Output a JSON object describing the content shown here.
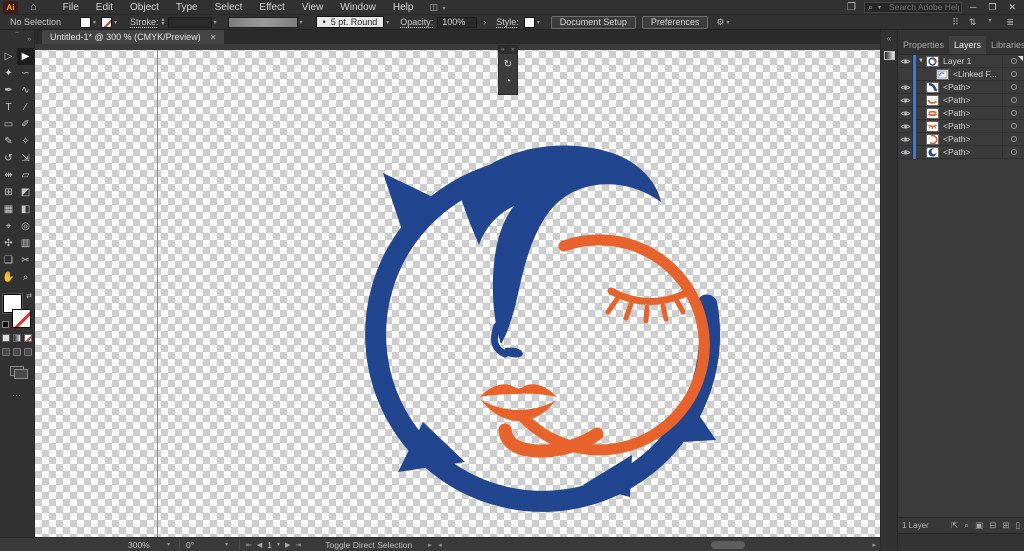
{
  "titlebar": {
    "app_badge": "Ai",
    "menus": [
      "File",
      "Edit",
      "Object",
      "Type",
      "Select",
      "Effect",
      "View",
      "Window",
      "Help"
    ],
    "search_placeholder": "Search Adobe Help",
    "icons": {
      "home": "⌂",
      "workspace": "◫",
      "arrange": "❐",
      "search": "⌕",
      "minimize": "─",
      "restore": "❐",
      "close": "✕",
      "chevron": "▾"
    }
  },
  "control_bar": {
    "selection_status": "No Selection",
    "stroke_label": "Stroke:",
    "brush_bullet": "•",
    "brush_preset": "5 pt. Round",
    "opacity_label": "Opacity:",
    "opacity_value": "100%",
    "opacity_more": "›",
    "style_label": "Style:",
    "document_setup_label": "Document Setup",
    "preferences_label": "Preferences",
    "right_icons": [
      {
        "name": "settings-icon",
        "glyph": "⚙"
      },
      {
        "name": "grid-icon",
        "glyph": "⠿"
      },
      {
        "name": "panel-toggle-icon",
        "glyph": "⇅"
      },
      {
        "name": "list-view-icon",
        "glyph": "≣"
      }
    ]
  },
  "document_tab": {
    "title": "Untitled-1* @ 300 % (CMYK/Preview)",
    "close_glyph": "✕"
  },
  "toolbar": {
    "more_glyph": "»",
    "ellipsis": "…",
    "tools": [
      {
        "name": "direct-selection-tool",
        "glyph": "▷",
        "active": false
      },
      {
        "name": "selection-tool",
        "glyph": "▶",
        "active": true
      },
      {
        "name": "magic-wand-tool",
        "glyph": "✦",
        "active": false
      },
      {
        "name": "lasso-tool",
        "glyph": "∽",
        "active": false
      },
      {
        "name": "pen-tool",
        "glyph": "✒",
        "active": false
      },
      {
        "name": "curvature-tool",
        "glyph": "∿",
        "active": false
      },
      {
        "name": "type-tool",
        "glyph": "T",
        "active": false
      },
      {
        "name": "line-segment-tool",
        "glyph": "∕",
        "active": false
      },
      {
        "name": "rectangle-tool",
        "glyph": "▭",
        "active": false
      },
      {
        "name": "paintbrush-tool",
        "glyph": "✐",
        "active": false
      },
      {
        "name": "pencil-tool",
        "glyph": "✎",
        "active": false
      },
      {
        "name": "shaper-tool",
        "glyph": "✧",
        "active": false
      },
      {
        "name": "rotate-tool",
        "glyph": "↺",
        "active": false
      },
      {
        "name": "scale-tool",
        "glyph": "⇲",
        "active": false
      },
      {
        "name": "width-tool",
        "glyph": "⇹",
        "active": false
      },
      {
        "name": "free-transform-tool",
        "glyph": "▱",
        "active": false
      },
      {
        "name": "shape-builder-tool",
        "glyph": "⊞",
        "active": false
      },
      {
        "name": "perspective-grid-tool",
        "glyph": "◩",
        "active": false
      },
      {
        "name": "mesh-tool",
        "glyph": "▦",
        "active": false
      },
      {
        "name": "gradient-tool",
        "glyph": "◧",
        "active": false
      },
      {
        "name": "eyedropper-tool",
        "glyph": "⌖",
        "active": false
      },
      {
        "name": "blend-tool",
        "glyph": "◎",
        "active": false
      },
      {
        "name": "symbol-sprayer-tool",
        "glyph": "✣",
        "active": false
      },
      {
        "name": "column-graph-tool",
        "glyph": "▥",
        "active": false
      },
      {
        "name": "artboard-tool",
        "glyph": "❏",
        "active": false
      },
      {
        "name": "slice-tool",
        "glyph": "✂",
        "active": false
      },
      {
        "name": "hand-tool",
        "glyph": "✋",
        "active": false
      },
      {
        "name": "zoom-tool",
        "glyph": "⌕",
        "active": false
      }
    ]
  },
  "floating_widget": {
    "close_glyph": "✕",
    "icons": [
      {
        "name": "rotate-view-icon",
        "glyph": "↻"
      },
      {
        "name": "gradient-widget-icon",
        "glyph": "◔"
      }
    ]
  },
  "right_dock": {
    "collapse_glyph": "«",
    "tabs": [
      "Properties",
      "Layers",
      "Libraries"
    ],
    "active_tab": "Layers",
    "menu_glyph": "≡",
    "layers": [
      {
        "name": "Layer 1",
        "visible": true,
        "kind": "layer",
        "indent": 0,
        "chevron": "▼"
      },
      {
        "name": "<Linked F...",
        "visible": false,
        "kind": "linked-file",
        "indent": 1,
        "chevron": ""
      },
      {
        "name": "<Path>",
        "visible": true,
        "kind": "path-nose",
        "indent": 0,
        "chevron": ""
      },
      {
        "name": "<Path>",
        "visible": true,
        "kind": "path-chin",
        "indent": 0,
        "chevron": ""
      },
      {
        "name": "<Path>",
        "visible": true,
        "kind": "path-lips",
        "indent": 0,
        "chevron": ""
      },
      {
        "name": "<Path>",
        "visible": true,
        "kind": "path-lashes",
        "indent": 0,
        "chevron": ""
      },
      {
        "name": "<Path>",
        "visible": true,
        "kind": "path-circle",
        "indent": 0,
        "chevron": ""
      },
      {
        "name": "<Path>",
        "visible": true,
        "kind": "path-ring",
        "indent": 0,
        "chevron": ""
      }
    ],
    "footer_count": "1 Layer",
    "footer_icons": [
      {
        "name": "collect-export-icon",
        "glyph": "⇱"
      },
      {
        "name": "locate-object-icon",
        "glyph": "⌕"
      },
      {
        "name": "clipping-mask-icon",
        "glyph": "▣"
      },
      {
        "name": "new-sublayer-icon",
        "glyph": "⊟"
      },
      {
        "name": "new-layer-icon",
        "glyph": "⊞"
      },
      {
        "name": "delete-selection-icon",
        "glyph": "▯"
      }
    ]
  },
  "status_bar": {
    "zoom": "300%",
    "rotation": "0°",
    "artboard_number": "1",
    "tool_hint": "Toggle Direct Selection",
    "icons": {
      "first": "⇤",
      "prev": "◀",
      "next": "▶",
      "last": "⇥",
      "chevron": "▾",
      "scroll_left": "◂",
      "scroll_right": "▸"
    }
  },
  "artwork": {
    "colors": {
      "blue": "#224590",
      "orange": "#E8622C"
    },
    "checker": {
      "light": "#FFFFFF",
      "dark": "#CECECE"
    }
  }
}
